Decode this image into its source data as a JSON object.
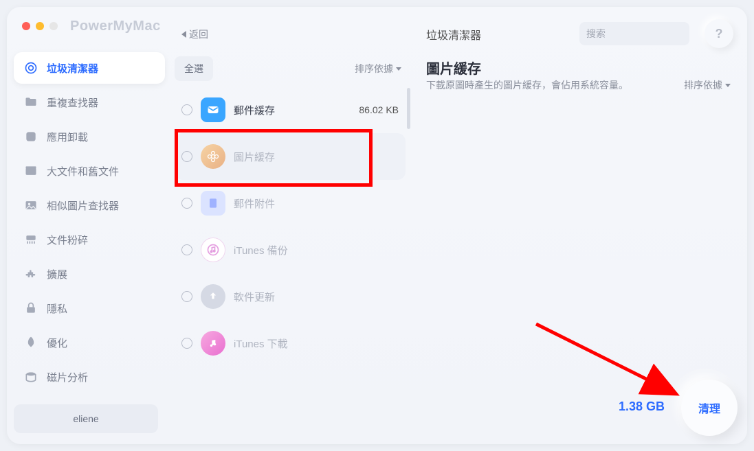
{
  "app": {
    "title": "PowerMyMac",
    "back_label": "返回",
    "header_module": "垃圾清潔器",
    "search_placeholder": "搜索",
    "help_label": "?"
  },
  "sidebar": {
    "items": [
      {
        "label": "垃圾清潔器"
      },
      {
        "label": "重複查找器"
      },
      {
        "label": "應用卸載"
      },
      {
        "label": "大文件和舊文件"
      },
      {
        "label": "相似圖片查找器"
      },
      {
        "label": "文件粉碎"
      },
      {
        "label": "擴展"
      },
      {
        "label": "隱私"
      },
      {
        "label": "優化"
      },
      {
        "label": "磁片分析"
      }
    ],
    "user": "eliene"
  },
  "mid": {
    "select_all": "全選",
    "sort_by": "排序依據",
    "items": [
      {
        "label": "郵件緩存",
        "size": "86.02 KB",
        "icon_bg": "#3aa6ff"
      },
      {
        "label": "圖片緩存",
        "size": "",
        "icon_bg": "linear-gradient(135deg,#f6d3a4,#e9b185)"
      },
      {
        "label": "郵件附件",
        "size": "",
        "icon_bg": "#c9d4ff"
      },
      {
        "label": "iTunes 備份",
        "size": "",
        "icon_bg": "#f3c6f0"
      },
      {
        "label": "軟件更新",
        "size": "",
        "icon_bg": "#d5d9e4"
      },
      {
        "label": "iTunes 下載",
        "size": "",
        "icon_bg": "#f3b6e4"
      }
    ]
  },
  "detail": {
    "title": "圖片緩存",
    "desc": "下載原圖時產生的圖片緩存，會佔用系統容量。",
    "sort_by": "排序依據"
  },
  "footer": {
    "total_size": "1.38 GB",
    "clean_label": "清理"
  },
  "annotations": {
    "highlight_item_index": 1
  }
}
